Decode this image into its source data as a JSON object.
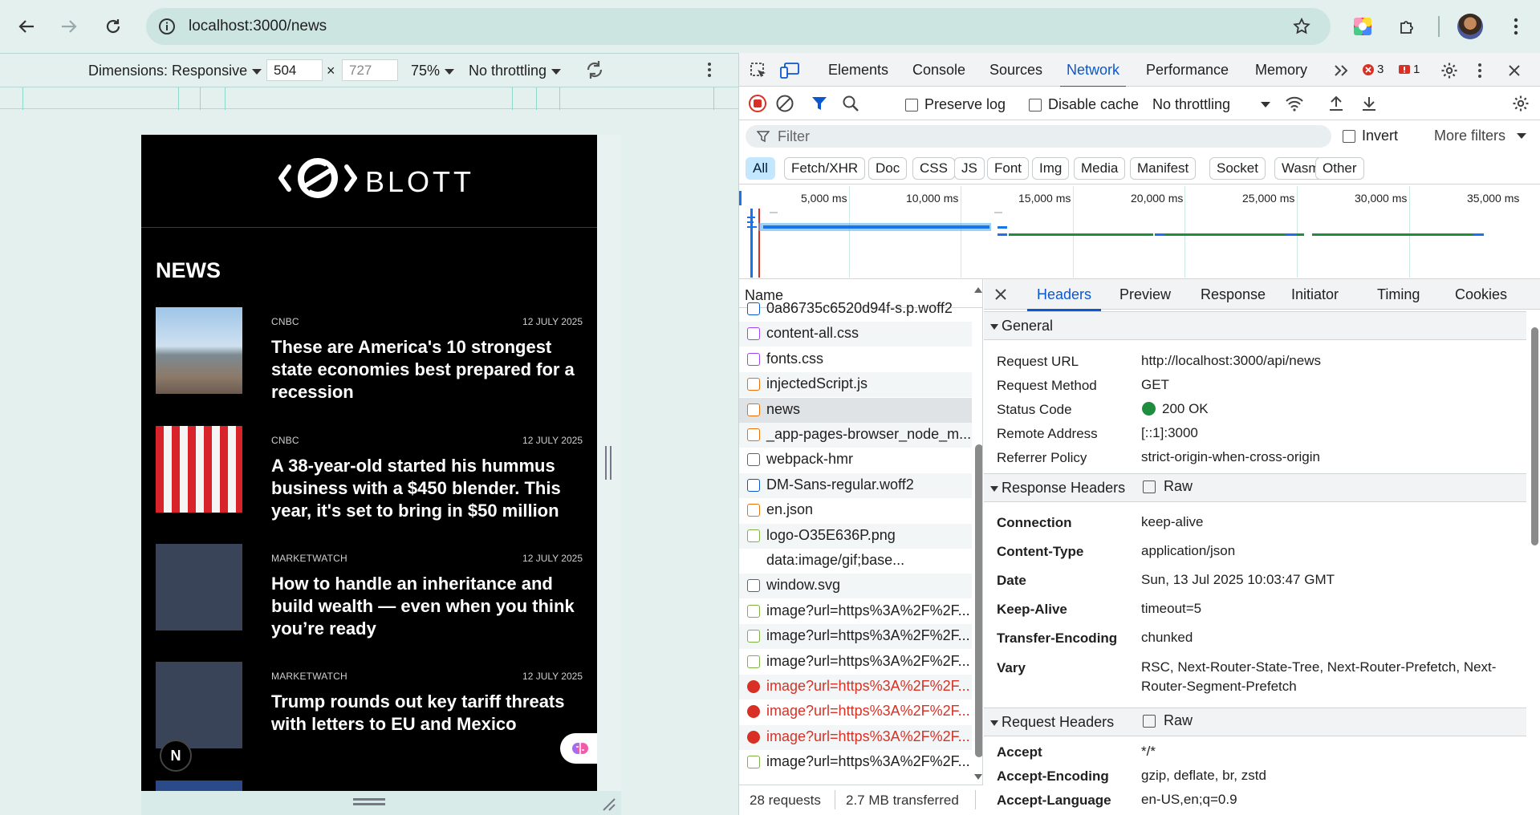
{
  "browser": {
    "url": "localhost:3000/news"
  },
  "device_toolbar": {
    "dimensions": "Dimensions: Responsive",
    "width": "504",
    "height": "727",
    "x_label": "×",
    "zoom": "75%",
    "throttling": "No throttling"
  },
  "site": {
    "brand": "BLOTT",
    "section_title": "NEWS",
    "next_badge": "N",
    "articles": [
      {
        "source": "CNBC",
        "date": "12 JULY 2025",
        "title": "These are America's 10 strongest state economies best prepared for a recession"
      },
      {
        "source": "CNBC",
        "date": "12 JULY 2025",
        "title": "A 38-year-old started his hummus business with a $450 blender. This year, it's set to bring in $50 million"
      },
      {
        "source": "MARKETWATCH",
        "date": "12 JULY 2025",
        "title": "How to handle an inheritance and build wealth — even when you think you’re ready"
      },
      {
        "source": "MARKETWATCH",
        "date": "12 JULY 2025",
        "title": "Trump rounds out key tariff threats with letters to EU and Mexico"
      }
    ]
  },
  "devtools": {
    "tabs": [
      "Elements",
      "Console",
      "Sources",
      "Network",
      "Performance",
      "Memory"
    ],
    "active_tab": "Network",
    "errors": "3",
    "warnings": "1",
    "toolbar": {
      "preserve_log": "Preserve log",
      "disable_cache": "Disable cache",
      "throttling": "No throttling"
    },
    "filter_placeholder": "Filter",
    "invert": "Invert",
    "more_filters": "More filters",
    "type_filters": [
      "All",
      "Fetch/XHR",
      "Doc",
      "CSS",
      "JS",
      "Font",
      "Img",
      "Media",
      "Manifest",
      "Socket",
      "Wasm",
      "Other"
    ],
    "timeline_labels": [
      "5,000 ms",
      "10,000 ms",
      "15,000 ms",
      "20,000 ms",
      "25,000 ms",
      "30,000 ms",
      "35,000 ms"
    ],
    "name_header": "Name",
    "requests": [
      {
        "name": "0a86735c6520d94f-s.p.woff2",
        "kind": "font",
        "state": "normal"
      },
      {
        "name": "content-all.css",
        "kind": "css",
        "state": "normal"
      },
      {
        "name": "fonts.css",
        "kind": "css",
        "state": "normal"
      },
      {
        "name": "injectedScript.js",
        "kind": "js",
        "state": "normal"
      },
      {
        "name": "news",
        "kind": "fetch",
        "state": "selected"
      },
      {
        "name": "_app-pages-browser_node_m...",
        "kind": "js",
        "state": "normal"
      },
      {
        "name": "webpack-hmr",
        "kind": "socket",
        "state": "normal"
      },
      {
        "name": "DM-Sans-regular.woff2",
        "kind": "font",
        "state": "normal"
      },
      {
        "name": "en.json",
        "kind": "fetch",
        "state": "normal"
      },
      {
        "name": "logo-O35E636P.png",
        "kind": "img",
        "state": "normal"
      },
      {
        "name": "data:image/gif;base...",
        "kind": "blank",
        "state": "normal"
      },
      {
        "name": "window.svg",
        "kind": "doc",
        "state": "normal"
      },
      {
        "name": "image?url=https%3A%2F%2F...",
        "kind": "img",
        "state": "normal"
      },
      {
        "name": "image?url=https%3A%2F%2F...",
        "kind": "img",
        "state": "normal"
      },
      {
        "name": "image?url=https%3A%2F%2F...",
        "kind": "img",
        "state": "normal"
      },
      {
        "name": "image?url=https%3A%2F%2F...",
        "kind": "error",
        "state": "error"
      },
      {
        "name": "image?url=https%3A%2F%2F...",
        "kind": "error",
        "state": "error"
      },
      {
        "name": "image?url=https%3A%2F%2F...",
        "kind": "error",
        "state": "error"
      },
      {
        "name": "image?url=https%3A%2F%2F...",
        "kind": "img",
        "state": "normal"
      }
    ],
    "status": {
      "requests": "28 requests",
      "transferred": "2.7 MB transferred"
    },
    "detail_tabs": [
      "Headers",
      "Preview",
      "Response",
      "Initiator",
      "Timing",
      "Cookies"
    ],
    "active_detail_tab": "Headers",
    "general": {
      "title": "General",
      "rows": [
        {
          "k": "Request URL",
          "v": "http://localhost:3000/api/news"
        },
        {
          "k": "Request Method",
          "v": "GET"
        },
        {
          "k": "Status Code",
          "v": "200 OK"
        },
        {
          "k": "Remote Address",
          "v": "[::1]:3000"
        },
        {
          "k": "Referrer Policy",
          "v": "strict-origin-when-cross-origin"
        }
      ]
    },
    "response_headers": {
      "title": "Response Headers",
      "raw": "Raw",
      "rows": [
        {
          "k": "Connection",
          "v": "keep-alive"
        },
        {
          "k": "Content-Type",
          "v": "application/json"
        },
        {
          "k": "Date",
          "v": "Sun, 13 Jul 2025 10:03:47 GMT"
        },
        {
          "k": "Keep-Alive",
          "v": "timeout=5"
        },
        {
          "k": "Transfer-Encoding",
          "v": "chunked"
        },
        {
          "k": "Vary",
          "v": "RSC, Next-Router-State-Tree, Next-Router-Prefetch, Next-Router-Segment-Prefetch"
        }
      ]
    },
    "request_headers": {
      "title": "Request Headers",
      "raw": "Raw",
      "rows": [
        {
          "k": "Accept",
          "v": "*/*"
        },
        {
          "k": "Accept-Encoding",
          "v": "gzip, deflate, br, zstd"
        },
        {
          "k": "Accept-Language",
          "v": "en-US,en;q=0.9"
        }
      ]
    }
  }
}
